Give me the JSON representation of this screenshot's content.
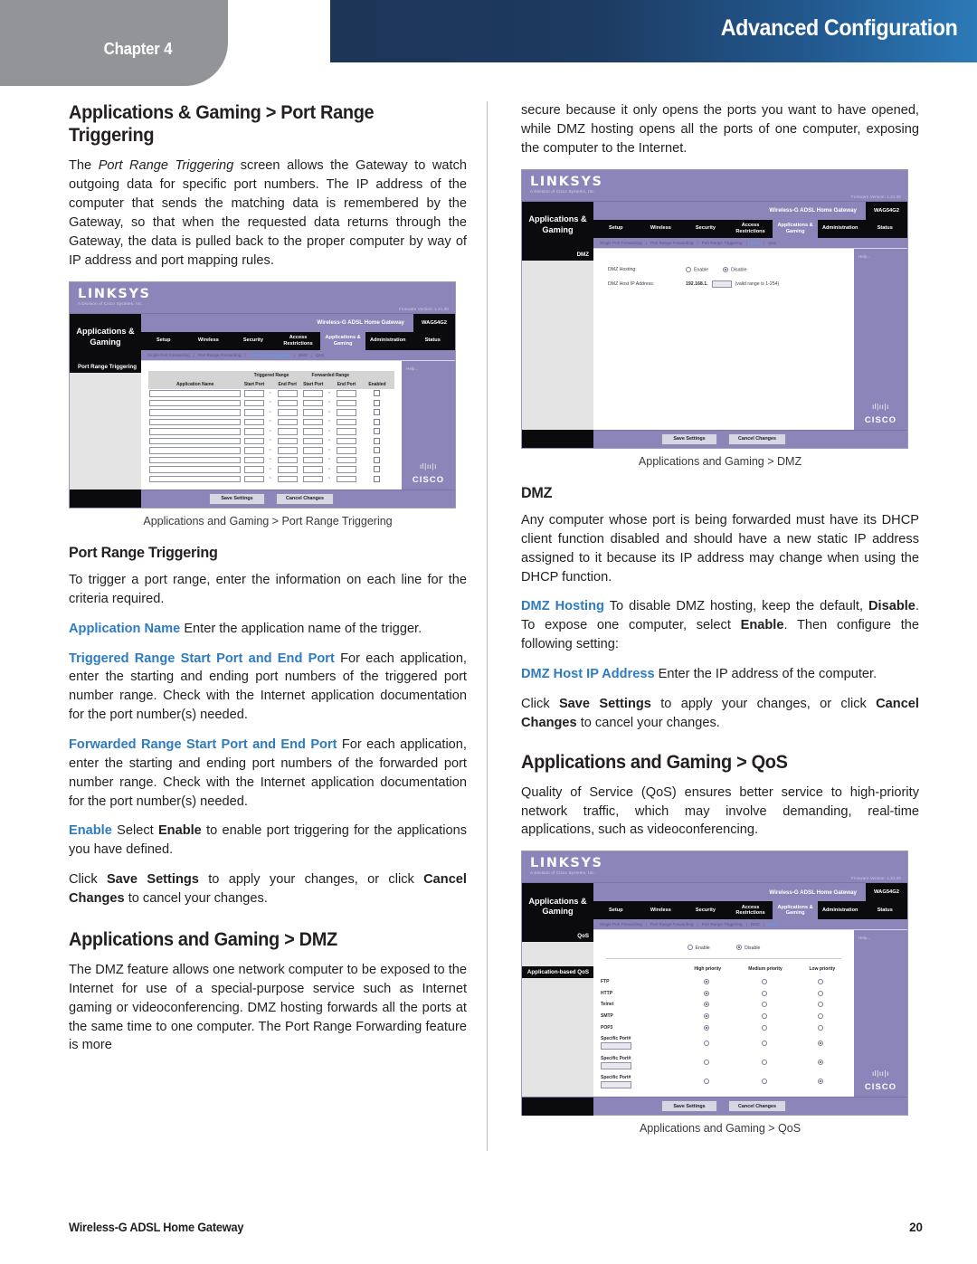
{
  "header": {
    "chapter_label": "Chapter 4",
    "banner_title": "Advanced Configuration",
    "banner_color_start": "#1d3557",
    "banner_color_end": "#2c7ab8",
    "chapter_tab_color": "#929497"
  },
  "accent_color": "#2e7bbf",
  "left_column": {
    "title": "Applications & Gaming > Port Range Triggering",
    "intro_prefix": "The ",
    "intro_italic": "Port Range Triggering",
    "intro_rest": " screen allows the Gateway to watch outgoing data for specific port numbers. The IP address of the computer that sends the matching data is remembered by the Gateway, so that when the requested data returns through the Gateway, the data is pulled back to the proper computer by way of IP address and port mapping rules.",
    "figure_caption": "Applications and Gaming > Port Range Triggering",
    "subtitle": "Port Range Triggering",
    "p1": "To trigger a port range, enter the information on each line for the criteria required.",
    "p2_term": "Application Name",
    "p2_text": " Enter the application name of the trigger.",
    "p3_term": "Triggered Range Start Port and End Port",
    "p3_text": " For each application, enter the starting and ending port numbers of the triggered port number range. Check with the Internet application documentation for the port number(s) needed.",
    "p4_term": "Forwarded Range Start Port and End Port",
    "p4_text": " For each application, enter the starting and ending port numbers of the forwarded port number range. Check with the Internet application documentation for the port number(s) needed.",
    "p5_term": "Enable",
    "p5_a": " Select ",
    "p5_b": "Enable",
    "p5_c": " to enable port triggering for the applications you have defined.",
    "p6_a": "Click ",
    "p6_b": "Save Settings",
    "p6_c": " to apply your changes, or click ",
    "p6_d": "Cancel Changes",
    "p6_e": " to cancel your changes.",
    "dmz_title": "Applications and Gaming > DMZ",
    "dmz_body": "The DMZ feature allows one network computer to be exposed to the Internet for use of a special-purpose service such as Internet gaming or videoconferencing. DMZ hosting forwards all the ports at the same time to one computer. The Port Range Forwarding feature is more"
  },
  "right_column": {
    "continuation": "secure because it only opens the ports you want to have opened, while DMZ hosting opens all the ports of one computer, exposing the computer to the Internet.",
    "dmz_figure_caption": "Applications and Gaming > DMZ",
    "dmz_heading": "DMZ",
    "dmz_p1": "Any computer whose port is being forwarded must have its DHCP client function disabled and should have a new static IP address assigned to it because its IP address may change when using the DHCP function.",
    "dmz_p2_term": "DMZ Hosting",
    "dmz_p2_a": "  To disable DMZ hosting, keep the default, ",
    "dmz_p2_b": "Disable",
    "dmz_p2_c": ". To expose one computer, select ",
    "dmz_p2_d": "Enable",
    "dmz_p2_e": ". Then configure the following setting:",
    "dmz_p3_term": "DMZ Host IP Address",
    "dmz_p3_text": " Enter the IP address of the computer.",
    "dmz_p4_a": "Click ",
    "dmz_p4_b": "Save Settings",
    "dmz_p4_c": " to apply your changes, or click ",
    "dmz_p4_d": "Cancel Changes",
    "dmz_p4_e": " to cancel your changes.",
    "qos_title": "Applications and Gaming > QoS",
    "qos_body": "Quality of Service (QoS) ensures better service to high-priority network traffic, which may involve demanding, real-time applications, such as videoconferencing.",
    "qos_figure_caption": "Applications and Gaming > QoS"
  },
  "router_ui": {
    "brand": "LINKSYS",
    "brand_sub": "A Division of Cisco Systems, Inc.",
    "firmware": "Firmware Version: 1.21.00",
    "model_name": "Wireless-G ADSL Home Gateway",
    "model_number": "WAG54G2",
    "side_label": "Applications & Gaming",
    "tabs": [
      "Setup",
      "Wireless",
      "Security",
      "Access Restrictions",
      "Applications & Gaming",
      "Administration",
      "Status"
    ],
    "active_tab": "Applications & Gaming",
    "subtabs": [
      "Single Port Forwarding",
      "Port Range Forwarding",
      "Port Range Triggering",
      "DMZ",
      "QoS"
    ],
    "help_label": "Help...",
    "save_button": "Save Settings",
    "cancel_button": "Cancel Changes",
    "cisco_word": "CISCO",
    "screen_port_range_triggering": {
      "panel_label": "Port Range Triggering",
      "group_headers": [
        "Triggered Range",
        "Forwarded Range"
      ],
      "columns": [
        "Application Name",
        "Start Port",
        "End Port",
        "Start Port",
        "End Port",
        "Enabled"
      ],
      "row_count": 10
    },
    "screen_dmz": {
      "panel_label": "DMZ",
      "hosting_label": "DMZ Hosting:",
      "enable_label": "Enable",
      "disable_label": "Disable",
      "selected": "Disable",
      "ip_label": "DMZ Host IP Address:",
      "ip_prefix": "192.168.1.",
      "ip_hint": "(valid range is 1-254)"
    },
    "screen_qos": {
      "panel_label": "QoS",
      "panel_label2": "Application-based QoS",
      "enable_label": "Enable",
      "disable_label": "Disable",
      "selected": "Disable",
      "priority_headers": [
        "High priority",
        "Medium priority",
        "Low priority"
      ],
      "rows": [
        {
          "name": "FTP",
          "selected": "High priority",
          "port_field": null
        },
        {
          "name": "HTTP",
          "selected": "High priority",
          "port_field": null
        },
        {
          "name": "Telnet",
          "selected": "High priority",
          "port_field": null
        },
        {
          "name": "SMTP",
          "selected": "High priority",
          "port_field": null
        },
        {
          "name": "POP3",
          "selected": "High priority",
          "port_field": null
        },
        {
          "name": "Specific Port#",
          "selected": "Low priority",
          "port_field": "0"
        },
        {
          "name": "Specific Port#",
          "selected": "Low priority",
          "port_field": "0"
        },
        {
          "name": "Specific Port#",
          "selected": "Low priority",
          "port_field": "0"
        }
      ]
    }
  },
  "footer": {
    "document_title": "Wireless-G ADSL Home Gateway",
    "page_number": "20"
  }
}
